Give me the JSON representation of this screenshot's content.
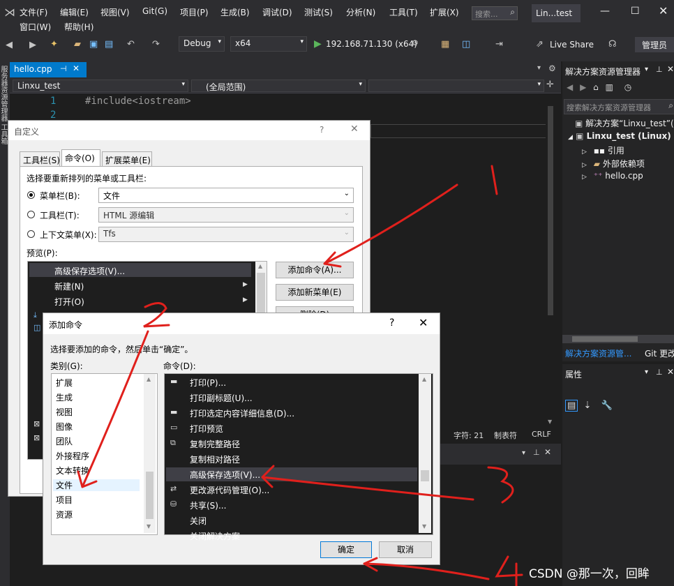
{
  "menubar": {
    "row1": [
      "文件(F)",
      "编辑(E)",
      "视图(V)",
      "Git(G)",
      "项目(P)",
      "生成(B)",
      "调试(D)",
      "测试(S)",
      "分析(N)",
      "工具(T)",
      "扩展(X)"
    ],
    "row2": [
      "窗口(W)",
      "帮助(H)"
    ],
    "search_placeholder": "搜索...",
    "title": "Lin...test"
  },
  "toolbar": {
    "config": "Debug",
    "platform": "x64",
    "run_target": "192.168.71.130 (x64)",
    "live_share": "Live Share",
    "admin": "管理员"
  },
  "editor": {
    "tab": "hello.cpp",
    "nav_project": "Linxu_test",
    "nav_scope": "(全局范围)",
    "lines": [
      "1",
      "2"
    ],
    "code": "#include<iostream>",
    "status": {
      "chars": "字符: 21",
      "tabs": "制表符",
      "eol": "CRLF"
    },
    "side_vertical": "服务器资源管理器  工具箱"
  },
  "solution_explorer": {
    "title": "解决方案资源管理器",
    "search_placeholder": "搜索解决方案资源管理器",
    "items": [
      "解决方案“Linxu_test”(1",
      "Linxu_test (Linux)",
      "引用",
      "外部依赖项",
      "hello.cpp"
    ],
    "bottom_tabs": [
      "解决方案资源管...",
      "Git 更改"
    ]
  },
  "properties": {
    "title": "属性"
  },
  "customize": {
    "title": "自定义",
    "tabs": [
      "工具栏(S)",
      "命令(O)",
      "扩展菜单(E)"
    ],
    "prompt": "选择要重新排列的菜单或工具栏:",
    "radios": [
      {
        "label": "菜单栏(B):",
        "value": "文件",
        "checked": true
      },
      {
        "label": "工具栏(T):",
        "value": "HTML 源编辑",
        "checked": false
      },
      {
        "label": "上下文菜单(X):",
        "value": "Tfs",
        "checked": false
      }
    ],
    "preview_label": "预览(P):",
    "preview_items": [
      "高级保存选项(V)...",
      "新建(N)",
      "打开(O)"
    ],
    "buttons": [
      "添加命令(A)...",
      "添加新菜单(E)",
      "删除(D)"
    ]
  },
  "addcmd": {
    "title": "添加命令",
    "instruction": "选择要添加的命令，然后单击“确定”。",
    "category_label": "类别(G):",
    "command_label": "命令(D):",
    "categories": [
      "扩展",
      "生成",
      "视图",
      "图像",
      "团队",
      "外接程序",
      "文本转换",
      "文件",
      "项目",
      "资源"
    ],
    "selected_category": "文件",
    "commands": [
      "打印(P)...",
      "打印副标题(U)...",
      "打印选定内容详细信息(D)...",
      "打印预览",
      "复制完整路径",
      "复制相对路径",
      "高级保存选项(V)...",
      "更改源代码管理(O)...",
      "共享(S)...",
      "关闭",
      "关闭解决方案"
    ],
    "selected_command": "高级保存选项(V)...",
    "ok": "确定",
    "cancel": "取消"
  },
  "annotations": [
    "1",
    "2",
    "3",
    "4"
  ],
  "watermark": "CSDN @那一次，回眸",
  "colors": {
    "accent": "#007acc",
    "annotation": "#e0201c",
    "vs_bg": "#2d2d30",
    "editor_bg": "#1e1e1e"
  }
}
